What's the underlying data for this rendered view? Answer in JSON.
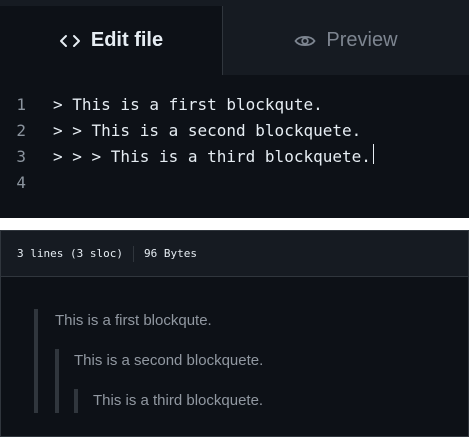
{
  "editor": {
    "tabs": {
      "edit_label": "Edit file",
      "preview_label": "Preview"
    },
    "lines": [
      {
        "number": "1",
        "text": "> This is a first blockqute."
      },
      {
        "number": "2",
        "text": "> > This is a second blockquete."
      },
      {
        "number": "3",
        "text": "> > > This is a third blockquete."
      },
      {
        "number": "4",
        "text": ""
      }
    ]
  },
  "preview": {
    "file_info": {
      "lines": "3 lines (3 sloc)",
      "size": "96 Bytes"
    },
    "blockquotes": [
      "This is a first blockqute.",
      "This is a second blockquete.",
      "This is a third blockquete."
    ]
  },
  "icons": {
    "edit": "code-icon",
    "preview": "eye-icon"
  },
  "colors": {
    "background": "#0d1117",
    "tabbar": "#161b22",
    "text": "#e6edf3",
    "muted": "#7d8590",
    "blockquote_border": "#30363d"
  }
}
